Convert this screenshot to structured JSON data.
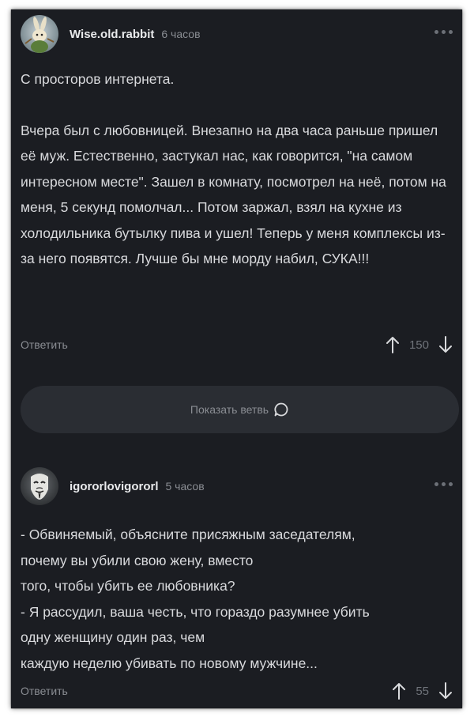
{
  "comments": [
    {
      "username": "Wise.old.rabbit",
      "time": "6 часов",
      "paragraphs": [
        "С просторов интернета.",
        "Вчера был с любовницей. Внезапно на два часа раньше пришел её муж. Естественно, застукал нас, как говорится, \"на самом интересном месте\". Зашел в комнату, посмотрел на неё, потом на меня, 5 секунд помолчал... Потом заржал, взял на кухне из холодильника бутылку пива и ушел! Теперь у меня комплексы из-за него появятся. Лучше бы мне морду набил, СУКА!!!"
      ],
      "reply_label": "Ответить",
      "score": "150",
      "avatar_icon": "rabbit-avatar"
    },
    {
      "username": "igororlovigororl",
      "time": "5 часов",
      "lines": [
        "- Обвиняемый, объясните присяжным заседателям,",
        "почему вы убили свою жену, вместо",
        "того, чтобы убить ее любовника?",
        "- Я рассудил, ваша честь, что гораздо разумнее убить",
        "одну женщину один раз, чем",
        "каждую неделю убивать по новому мужчине..."
      ],
      "reply_label": "Ответить",
      "score": "55",
      "avatar_icon": "mask-avatar"
    }
  ],
  "branch_button": {
    "label": "Показать ветвь",
    "icon": "chat-bubble-icon"
  },
  "colors": {
    "background": "#1b1d22",
    "text": "#d9dadd",
    "muted": "#8a8d93",
    "pill": "#2a2d33"
  }
}
